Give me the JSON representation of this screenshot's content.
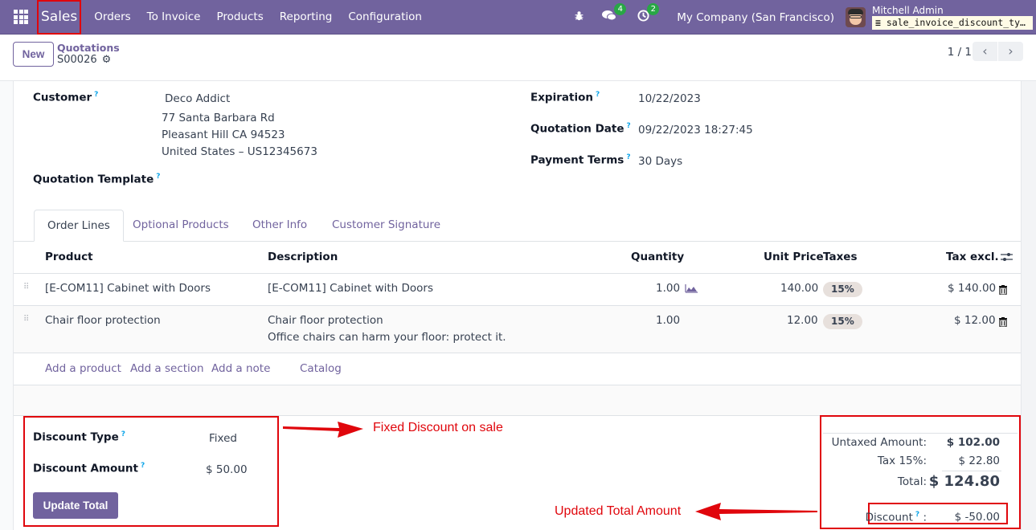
{
  "navbar": {
    "app_name": "Sales",
    "menu": [
      "Orders",
      "To Invoice",
      "Products",
      "Reporting",
      "Configuration"
    ],
    "messages_count": "4",
    "activities_count": "2",
    "company": "My Company (San Francisco)",
    "user_name": "Mitchell Admin",
    "database": "sale_invoice_discount_ty…"
  },
  "control_panel": {
    "new_label": "New",
    "breadcrumb": "Quotations",
    "record_name": "S00026",
    "pager": "1 / 1"
  },
  "form": {
    "customer_label": "Customer",
    "customer_name": "Deco Addict",
    "customer_address": [
      "77 Santa Barbara Rd",
      "Pleasant Hill CA 94523",
      "United States – US12345673"
    ],
    "template_label": "Quotation Template",
    "expiration_label": "Expiration",
    "expiration_value": "10/22/2023",
    "quotation_date_label": "Quotation Date",
    "quotation_date_value": "09/22/2023 18:27:45",
    "payment_terms_label": "Payment Terms",
    "payment_terms_value": "30 Days"
  },
  "tabs": [
    "Order Lines",
    "Optional Products",
    "Other Info",
    "Customer Signature"
  ],
  "table": {
    "headers": {
      "product": "Product",
      "description": "Description",
      "quantity": "Quantity",
      "unit_price": "Unit Price",
      "taxes": "Taxes",
      "subtotal": "Tax excl."
    },
    "rows": [
      {
        "product": "[E-COM11] Cabinet with Doors",
        "description": [
          "[E-COM11] Cabinet with Doors"
        ],
        "quantity": "1.00",
        "unit_price": "140.00",
        "taxes": "15%",
        "subtotal": "$ 140.00"
      },
      {
        "product": "Chair floor protection",
        "description": [
          "Chair floor protection",
          "Office chairs can harm your floor: protect it."
        ],
        "quantity": "1.00",
        "unit_price": "12.00",
        "taxes": "15%",
        "subtotal": "$ 12.00"
      }
    ],
    "add_links": [
      "Add a product",
      "Add a section",
      "Add a note",
      "Catalog"
    ]
  },
  "discount": {
    "type_label": "Discount Type",
    "type_value": "Fixed",
    "amount_label": "Discount Amount",
    "amount_value": "$ 50.00",
    "update_button": "Update Total"
  },
  "totals": {
    "untaxed_label": "Untaxed Amount:",
    "untaxed_value": "$ 102.00",
    "tax_label": "Tax 15%:",
    "tax_value": "$ 22.80",
    "total_label": "Total:",
    "total_value": "$ 124.80",
    "discount_label": "Discount",
    "discount_value": "$ -50.00"
  },
  "annotations": {
    "fixed_discount": "Fixed Discount on sale",
    "updated_total": "Updated Total Amount"
  },
  "colors": {
    "brand": "#71639e",
    "annotation": "#e0060c",
    "badge": "#28a745"
  }
}
